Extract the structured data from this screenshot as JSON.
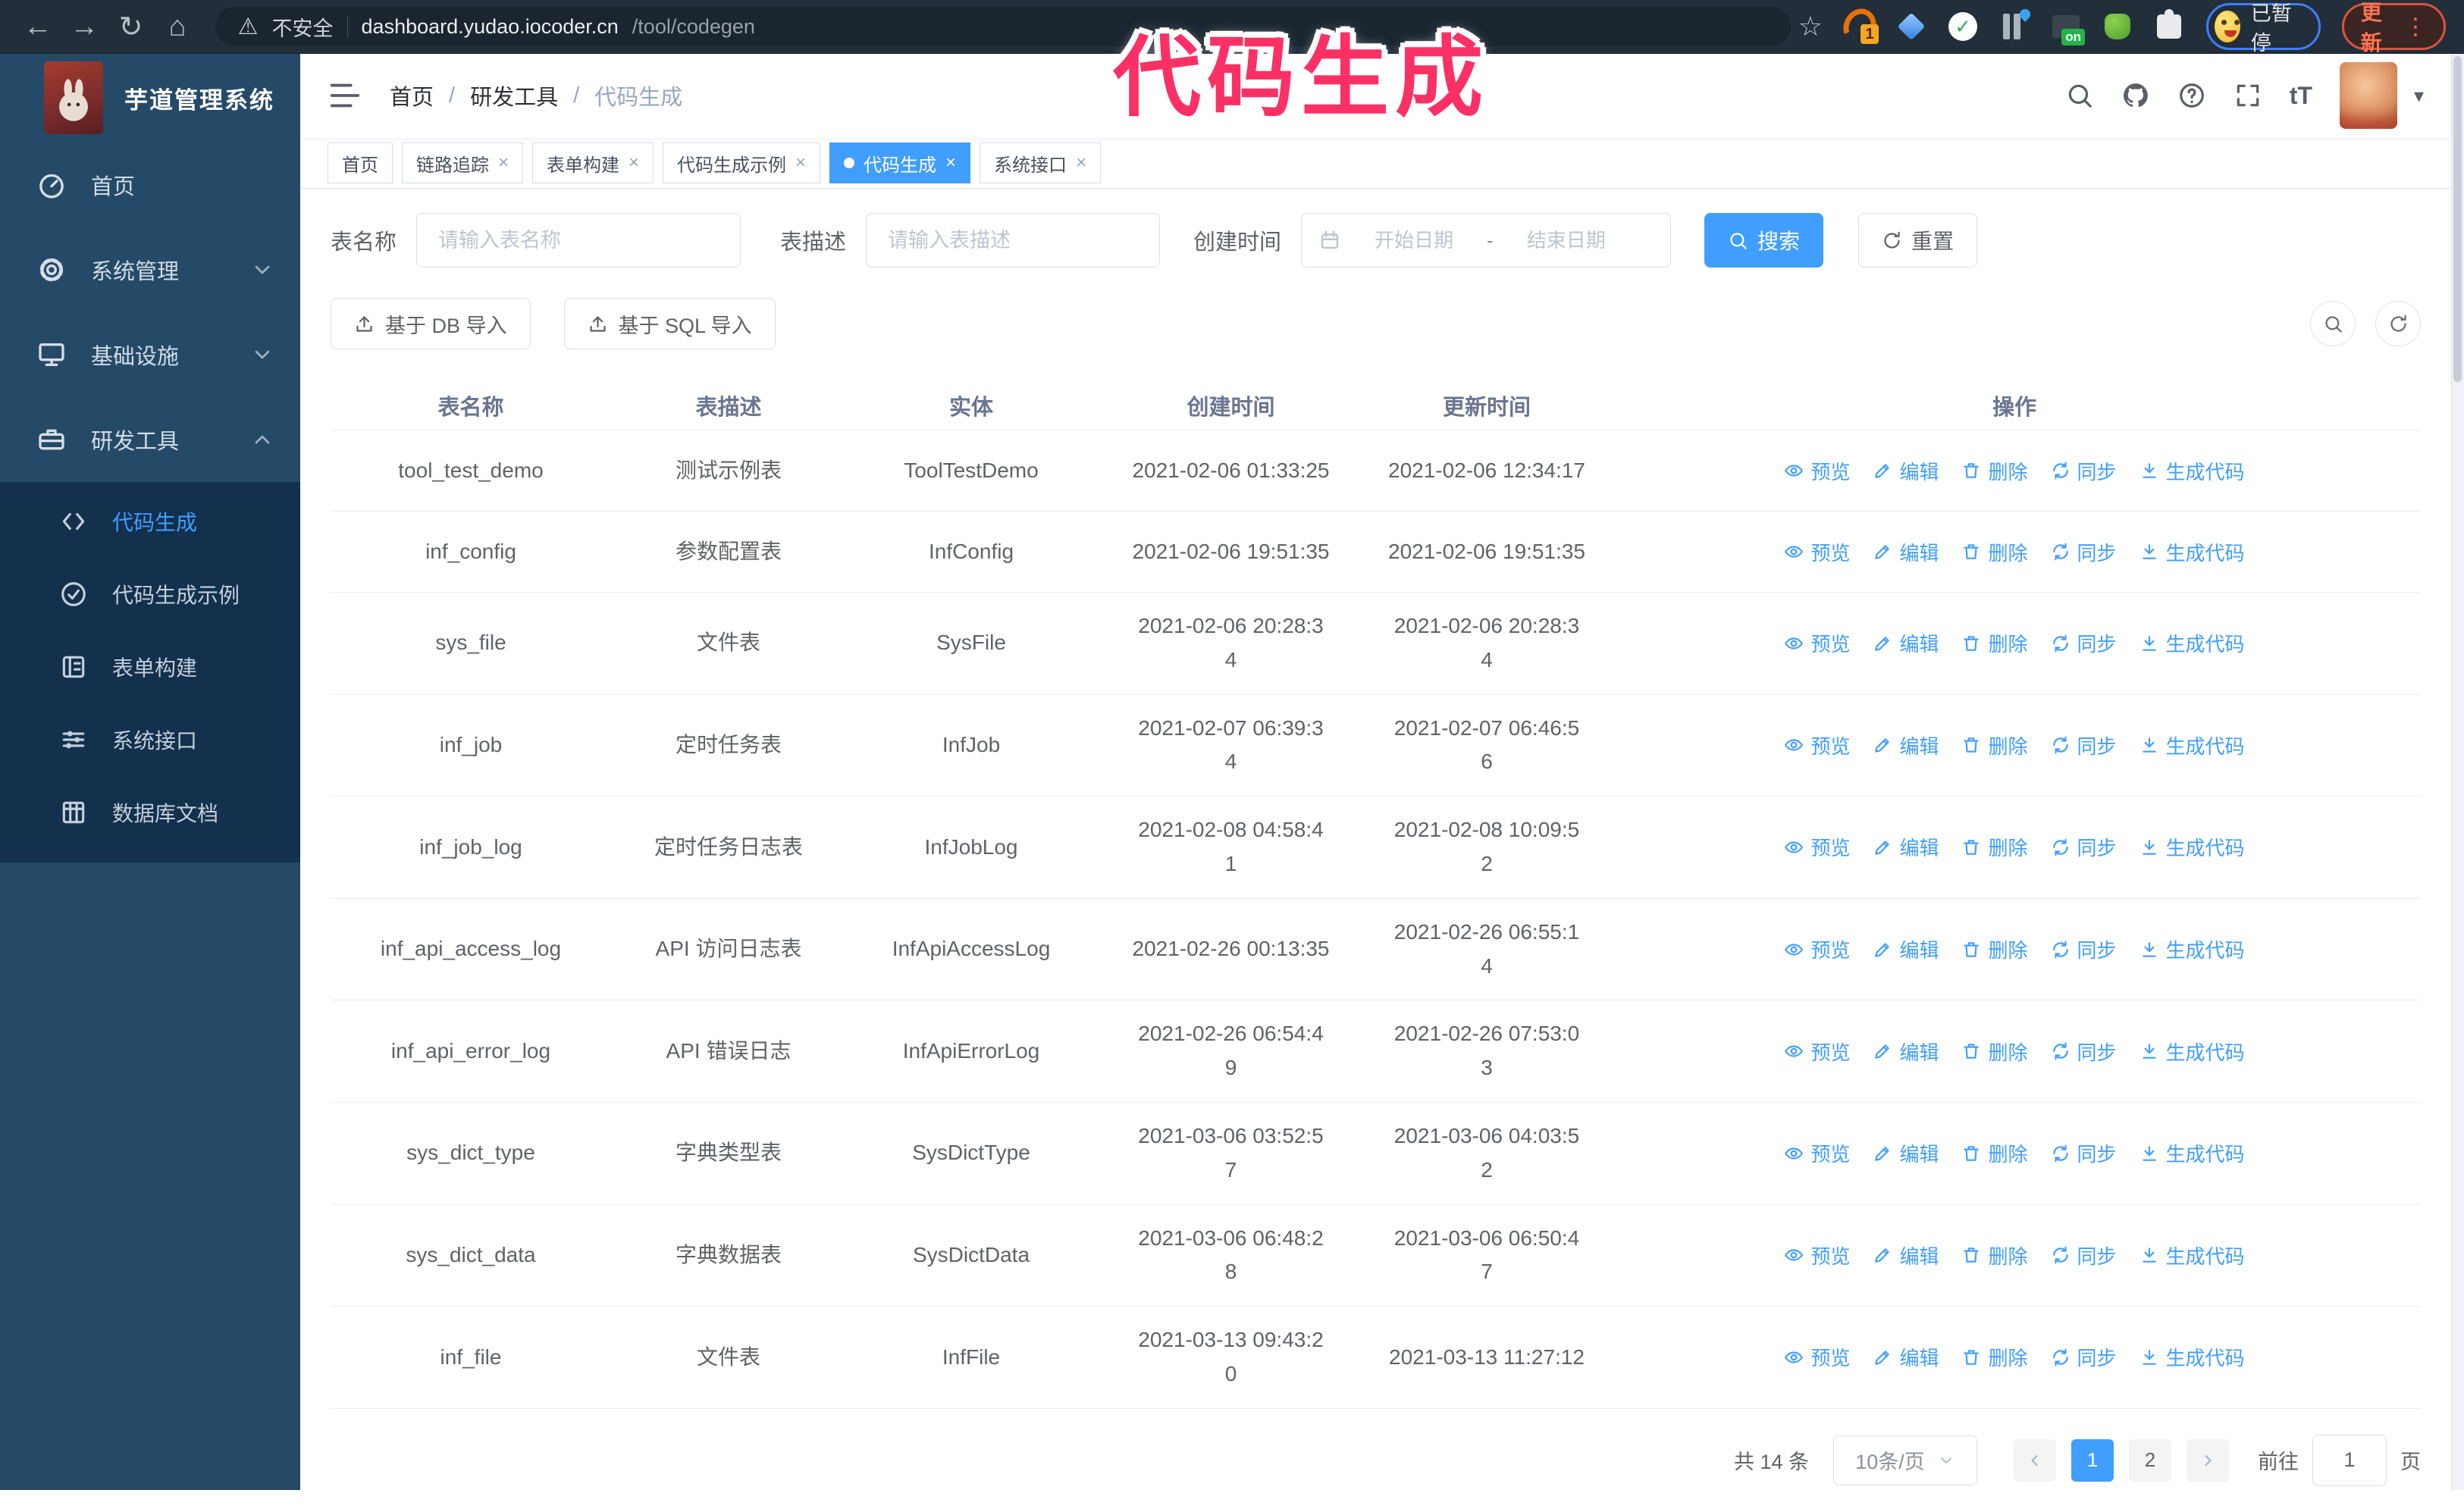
{
  "browser": {
    "security_label": "不安全",
    "url_host": "dashboard.yudao.iocoder.cn",
    "url_path": "/tool/codegen",
    "paused_label": "已暂停",
    "update_label": "更新"
  },
  "icons": {
    "back": "←",
    "forward": "→",
    "reload": "↻",
    "home": "⌂",
    "star": "☆",
    "warning": "⚠",
    "dots": "⋮",
    "caret": "▾",
    "check": "✓"
  },
  "overlay_text": "代码生成",
  "logo": {
    "title": "芋道管理系统"
  },
  "breadcrumb": {
    "items": [
      "首页",
      "研发工具",
      "代码生成"
    ],
    "separator": "/"
  },
  "tabs": [
    {
      "label": "首页"
    },
    {
      "label": "链路追踪"
    },
    {
      "label": "表单构建"
    },
    {
      "label": "代码生成示例"
    },
    {
      "label": "代码生成"
    },
    {
      "label": "系统接口"
    }
  ],
  "sidebar": {
    "items": [
      {
        "label": "首页"
      },
      {
        "label": "系统管理"
      },
      {
        "label": "基础设施"
      },
      {
        "label": "研发工具"
      }
    ],
    "sub_items": [
      {
        "label": "代码生成"
      },
      {
        "label": "代码生成示例"
      },
      {
        "label": "表单构建"
      },
      {
        "label": "系统接口"
      },
      {
        "label": "数据库文档"
      }
    ]
  },
  "search": {
    "name_label": "表名称",
    "name_placeholder": "请输入表名称",
    "desc_label": "表描述",
    "desc_placeholder": "请输入表描述",
    "time_label": "创建时间",
    "start_placeholder": "开始日期",
    "range_separator": "-",
    "end_placeholder": "结束日期",
    "search_label": "搜索",
    "reset_label": "重置"
  },
  "toolbar": {
    "import_db_label": "基于 DB 导入",
    "import_sql_label": "基于 SQL 导入"
  },
  "table": {
    "columns": [
      "表名称",
      "表描述",
      "实体",
      "创建时间",
      "更新时间",
      "操作"
    ],
    "actions": [
      "预览",
      "编辑",
      "删除",
      "同步",
      "生成代码"
    ],
    "rows": [
      {
        "name": "tool_test_demo",
        "desc": "测试示例表",
        "entity": "ToolTestDemo",
        "created": "2021-02-06 01:33:25",
        "updated": "2021-02-06 12:34:17"
      },
      {
        "name": "inf_config",
        "desc": "参数配置表",
        "entity": "InfConfig",
        "created": "2021-02-06 19:51:35",
        "updated": "2021-02-06 19:51:35"
      },
      {
        "name": "sys_file",
        "desc": "文件表",
        "entity": "SysFile",
        "created": "2021-02-06 20:28:3\n4",
        "updated": "2021-02-06 20:28:3\n4"
      },
      {
        "name": "inf_job",
        "desc": "定时任务表",
        "entity": "InfJob",
        "created": "2021-02-07 06:39:3\n4",
        "updated": "2021-02-07 06:46:5\n6"
      },
      {
        "name": "inf_job_log",
        "desc": "定时任务日志表",
        "entity": "InfJobLog",
        "created": "2021-02-08 04:58:4\n1",
        "updated": "2021-02-08 10:09:5\n2"
      },
      {
        "name": "inf_api_access_log",
        "desc": "API 访问日志表",
        "entity": "InfApiAccessLog",
        "created": "2021-02-26 00:13:35",
        "updated": "2021-02-26 06:55:1\n4"
      },
      {
        "name": "inf_api_error_log",
        "desc": "API 错误日志",
        "entity": "InfApiErrorLog",
        "created": "2021-02-26 06:54:4\n9",
        "updated": "2021-02-26 07:53:0\n3"
      },
      {
        "name": "sys_dict_type",
        "desc": "字典类型表",
        "entity": "SysDictType",
        "created": "2021-03-06 03:52:5\n7",
        "updated": "2021-03-06 04:03:5\n2"
      },
      {
        "name": "sys_dict_data",
        "desc": "字典数据表",
        "entity": "SysDictData",
        "created": "2021-03-06 06:48:2\n8",
        "updated": "2021-03-06 06:50:4\n7"
      },
      {
        "name": "inf_file",
        "desc": "文件表",
        "entity": "InfFile",
        "created": "2021-03-13 09:43:2\n0",
        "updated": "2021-03-13 11:27:12"
      }
    ]
  },
  "pagination": {
    "total": "共 14 条",
    "page_size": "10条/页",
    "pages": [
      "1",
      "2"
    ],
    "goto_label": "前往",
    "goto_value": "1",
    "unit_label": "页"
  },
  "colors": {
    "accent": "#409eff",
    "sidebar": "#254a68",
    "sidebar_submenu": "#13304d",
    "chrome": "#222e39",
    "overlay_pink": "#fb3064",
    "update_button": "#ff7350"
  }
}
